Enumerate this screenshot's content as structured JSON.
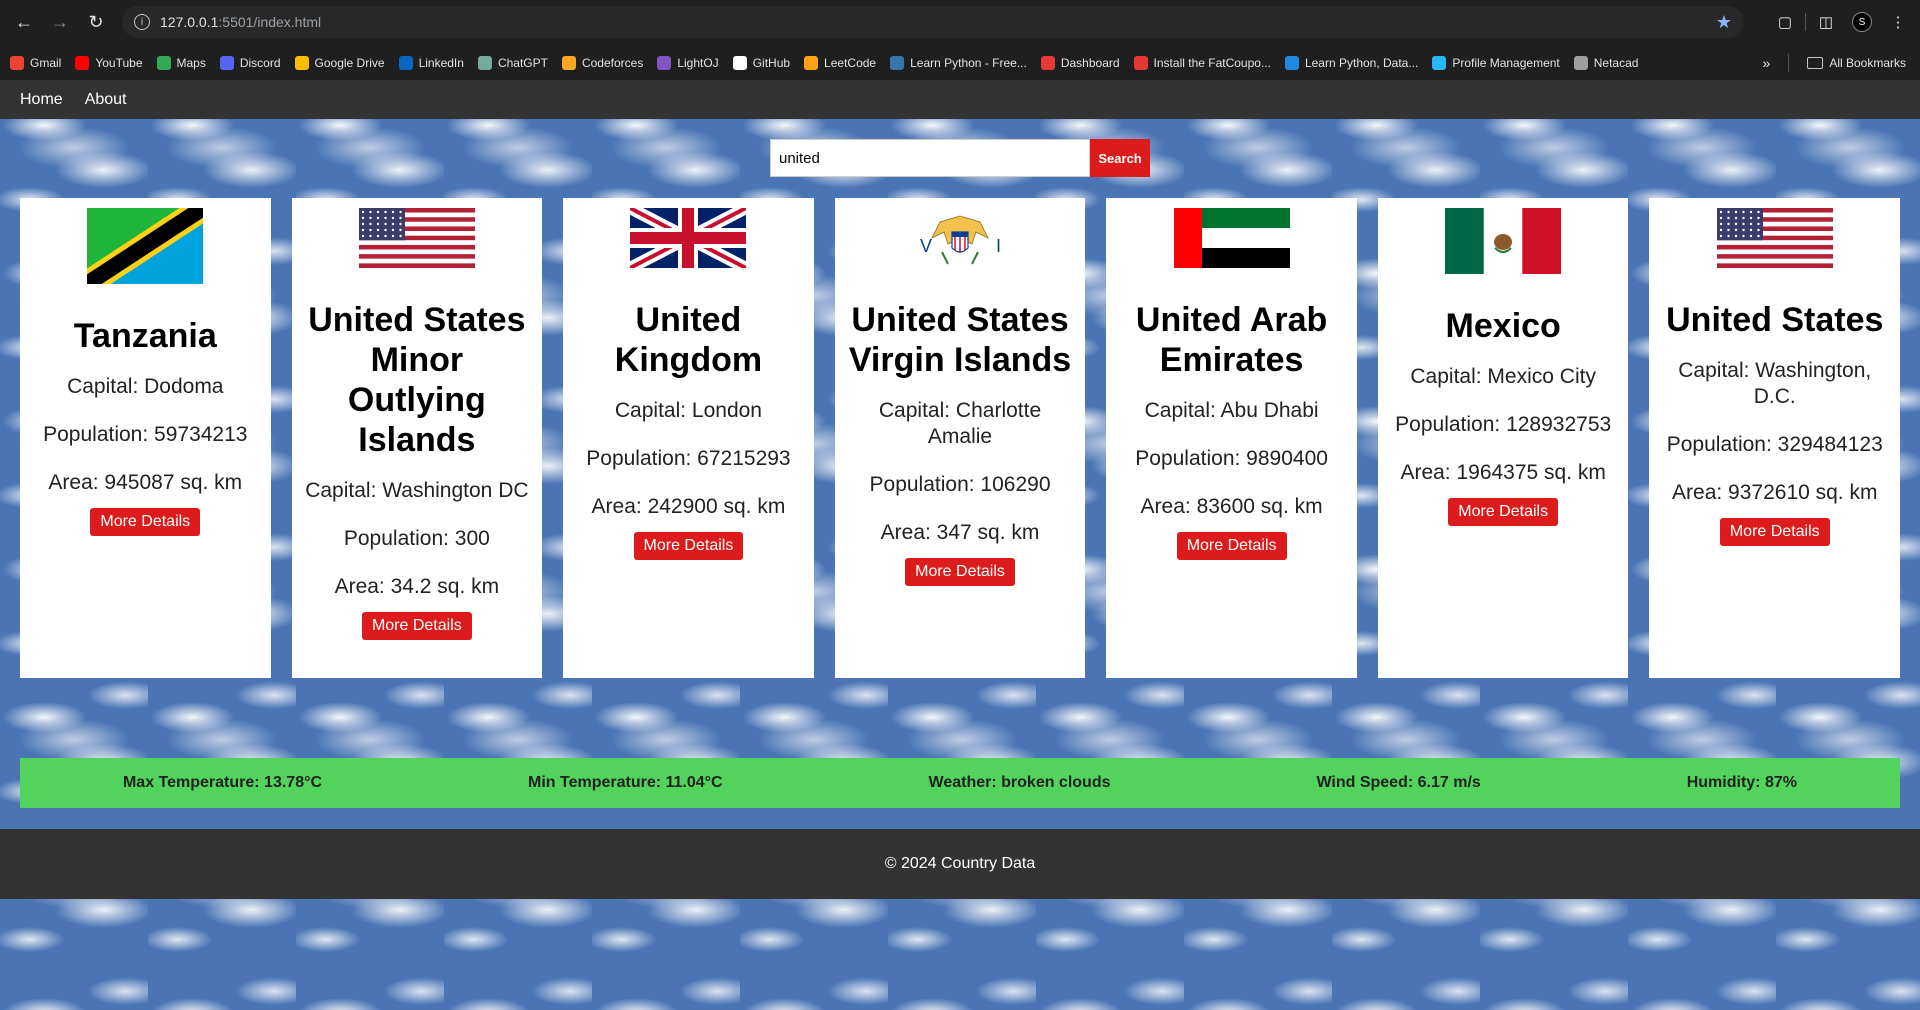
{
  "browser": {
    "url_host": "127.0.0.1",
    "url_path": ":5501/index.html",
    "bookmarks": [
      {
        "label": "Gmail",
        "color": "#ea4335"
      },
      {
        "label": "YouTube",
        "color": "#ff0000"
      },
      {
        "label": "Maps",
        "color": "#34a853"
      },
      {
        "label": "Discord",
        "color": "#5865f2"
      },
      {
        "label": "Google Drive",
        "color": "#fbbc04"
      },
      {
        "label": "LinkedIn",
        "color": "#0a66c2"
      },
      {
        "label": "ChatGPT",
        "color": "#74aa9c"
      },
      {
        "label": "Codeforces",
        "color": "#f9a825"
      },
      {
        "label": "LightOJ",
        "color": "#7e57c2"
      },
      {
        "label": "GitHub",
        "color": "#ffffff"
      },
      {
        "label": "LeetCode",
        "color": "#ffa116"
      },
      {
        "label": "Learn Python - Free...",
        "color": "#3776ab"
      },
      {
        "label": "Dashboard",
        "color": "#e53935"
      },
      {
        "label": "Install the FatCoupo...",
        "color": "#e53935"
      },
      {
        "label": "Learn Python, Data...",
        "color": "#1e88e5"
      },
      {
        "label": "Profile Management",
        "color": "#29b6f6"
      },
      {
        "label": "Netacad",
        "color": "#9e9e9e"
      }
    ],
    "all_bookmarks": "All Bookmarks"
  },
  "nav": {
    "home": "Home",
    "about": "About"
  },
  "search": {
    "value": "united",
    "button": "Search"
  },
  "cards": [
    {
      "name": "Tanzania",
      "capital": "Capital: Dodoma",
      "population": "Population: 59734213",
      "area": "Area: 945087 sq. km",
      "button": "More Details",
      "flag": "tanzania-flag"
    },
    {
      "name": "United States Minor Outlying Islands",
      "capital": "Capital: Washington DC",
      "population": "Population: 300",
      "area": "Area: 34.2 sq. km",
      "button": "More Details",
      "flag": "us-flag"
    },
    {
      "name": "United Kingdom",
      "capital": "Capital: London",
      "population": "Population: 67215293",
      "area": "Area: 242900 sq. km",
      "button": "More Details",
      "flag": "uk-flag"
    },
    {
      "name": "United States Virgin Islands",
      "capital": "Capital: Charlotte Amalie",
      "population": "Population: 106290",
      "area": "Area: 347 sq. km",
      "button": "More Details",
      "flag": "usvi-flag"
    },
    {
      "name": "United Arab Emirates",
      "capital": "Capital: Abu Dhabi",
      "population": "Population: 9890400",
      "area": "Area: 83600 sq. km",
      "button": "More Details",
      "flag": "uae-flag"
    },
    {
      "name": "Mexico",
      "capital": "Capital: Mexico City",
      "population": "Population: 128932753",
      "area": "Area: 1964375 sq. km",
      "button": "More Details",
      "flag": "mexico-flag"
    },
    {
      "name": "United States",
      "capital": "Capital: Washington, D.C.",
      "population": "Population: 329484123",
      "area": "Area: 9372610 sq. km",
      "button": "More Details",
      "flag": "us-flag"
    }
  ],
  "weather": {
    "max_temp": "Max Temperature: 13.78°C",
    "min_temp": "Min Temperature: 11.04°C",
    "condition": "Weather: broken clouds",
    "wind": "Wind Speed: 6.17 m/s",
    "humidity": "Humidity: 87%"
  },
  "footer": "© 2024 Country Data",
  "colors": {
    "accent_red": "#dc1c1c",
    "weather_bar": "#52d35c",
    "navbar": "#333333"
  }
}
